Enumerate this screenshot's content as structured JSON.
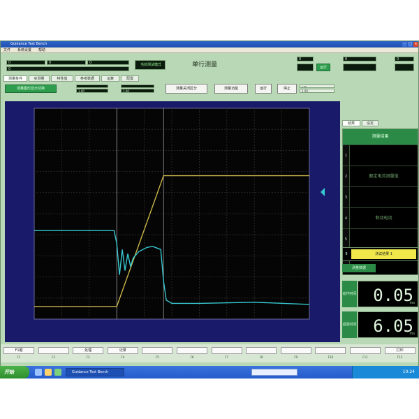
{
  "window": {
    "title": "Guidance Test Bench",
    "menu": [
      "文件",
      "系统设置",
      "帮助"
    ]
  },
  "header": {
    "mode_label": "当前测试模式",
    "title": "单行测量",
    "fields_left": [
      "0",
      "0",
      "0",
      "0"
    ],
    "fields_right": [
      "0",
      "0",
      "0"
    ],
    "status_btn": "运行"
  },
  "tabs": [
    "测量条件",
    "实测量",
    "特性值",
    "参考数据",
    "运算",
    "配置"
  ],
  "toolbar": {
    "tool_btn": "测量图形显示切换",
    "btn_a": "测量关闭区分",
    "btn_b": "测量功能",
    "btn_c": "运行",
    "btn_d": "停止",
    "small_fields": [
      "1.00",
      "1.00",
      "1.00",
      "1.00"
    ]
  },
  "right_panel": {
    "tabs": [
      "结果",
      "设定"
    ],
    "header_label": "测量结果",
    "rows": [
      {
        "n": "1",
        "label": ""
      },
      {
        "n": "2",
        "label": "额定电流测量值"
      },
      {
        "n": "3",
        "label": ""
      },
      {
        "n": "4",
        "label": "制动电流"
      },
      {
        "n": "5",
        "label": ""
      },
      {
        "n": "6",
        "label": ""
      }
    ],
    "highlight_row": {
      "n": "9",
      "label": "测试结果 1"
    },
    "section_label": "测量数据",
    "readouts": [
      {
        "side_label": "动作时间",
        "value": "0.05",
        "unit": "ms"
      },
      {
        "side_label": "返回时间",
        "value": "6.05",
        "unit": "ms"
      }
    ]
  },
  "fkeys": [
    {
      "label": "F1键",
      "caption": "F1"
    },
    {
      "label": "",
      "caption": "F2"
    },
    {
      "label": "处理",
      "caption": "F3"
    },
    {
      "label": "记录",
      "caption": "F4"
    },
    {
      "label": "",
      "caption": "F5"
    },
    {
      "label": "",
      "caption": "F6"
    },
    {
      "label": "",
      "caption": "F7"
    },
    {
      "label": "",
      "caption": "F8"
    },
    {
      "label": "",
      "caption": "F9"
    },
    {
      "label": "",
      "caption": "F10"
    },
    {
      "label": "",
      "caption": "F11"
    },
    {
      "label": "打印",
      "caption": "F12"
    }
  ],
  "taskbar": {
    "start": "开始",
    "item": "Guidance Test Bench",
    "clock": "10:24"
  },
  "chart_data": {
    "type": "line",
    "x_range": [
      0,
      10
    ],
    "y_range": [
      0,
      10
    ],
    "grid": true,
    "cursor_x": [
      3.0,
      4.7
    ],
    "series": [
      {
        "color": "#c8b44a",
        "x": [
          0,
          3.0,
          4.7,
          10
        ],
        "y": [
          0.6,
          0.6,
          6.8,
          6.8
        ]
      },
      {
        "color": "#38c8d0",
        "x": [
          0,
          2.9,
          3.0,
          3.1,
          3.2,
          3.3,
          3.4,
          3.5,
          3.6,
          3.8,
          4.1,
          4.3,
          4.4,
          4.6,
          4.7,
          4.8,
          5.0,
          6.0,
          8.0,
          10
        ],
        "y": [
          4.2,
          4.2,
          3.6,
          2.1,
          3.3,
          2.3,
          3.1,
          2.5,
          2.9,
          3.2,
          3.4,
          3.45,
          3.4,
          3.3,
          1.8,
          0.9,
          0.75,
          0.75,
          0.8,
          0.7
        ]
      }
    ]
  }
}
